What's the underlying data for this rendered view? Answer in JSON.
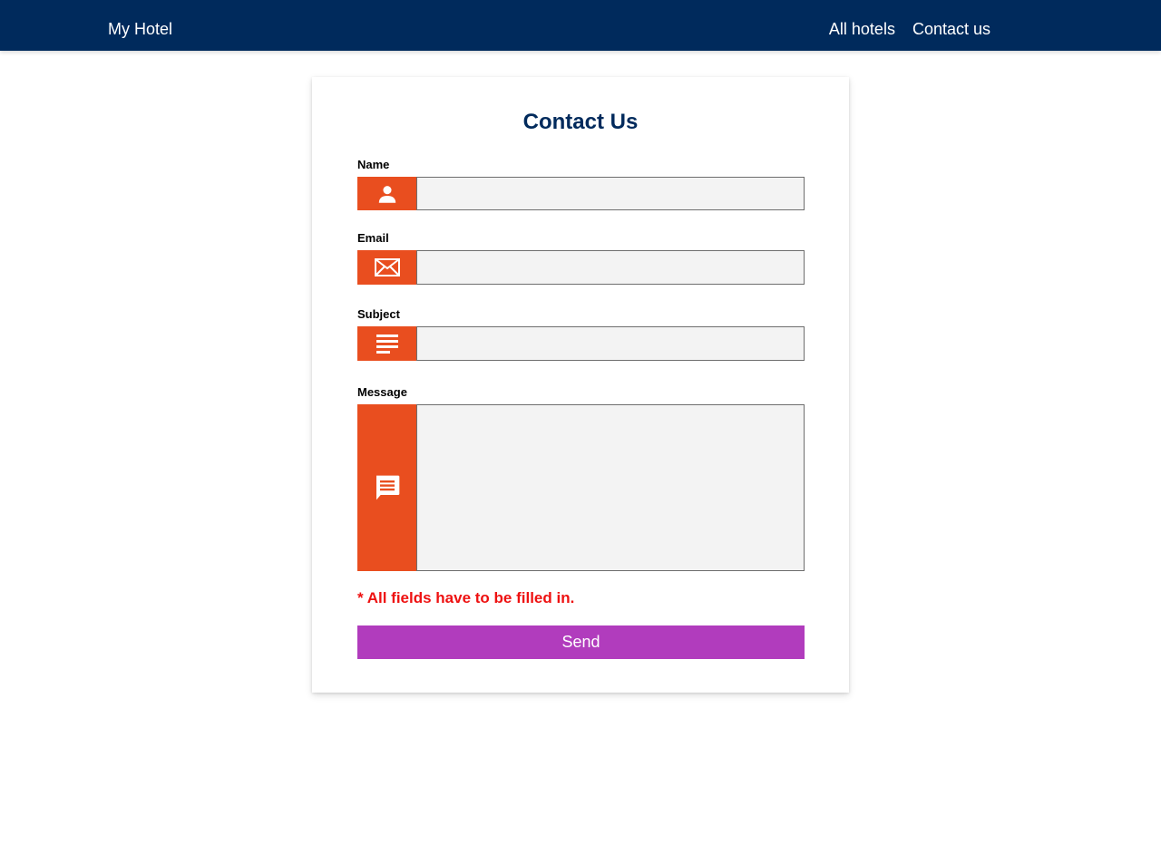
{
  "colors": {
    "navbar": "#002a5c",
    "title": "#002a5c",
    "icon_accent": "#e94e1f",
    "input_bg": "#f3f3f3",
    "error": "#ee1111",
    "send_button": "#b13cbd"
  },
  "navbar": {
    "brand": "My Hotel",
    "links": [
      {
        "label": "All hotels"
      },
      {
        "label": "Contact us"
      }
    ]
  },
  "form": {
    "title": "Contact Us",
    "fields": [
      {
        "label": "Name",
        "icon": "person-icon",
        "value": ""
      },
      {
        "label": "Email",
        "icon": "envelope-icon",
        "value": ""
      },
      {
        "label": "Subject",
        "icon": "subject-lines-icon",
        "value": ""
      },
      {
        "label": "Message",
        "icon": "message-bubble-icon",
        "value": ""
      }
    ],
    "required_note": "* All fields have to be filled in.",
    "send_label": "Send"
  }
}
